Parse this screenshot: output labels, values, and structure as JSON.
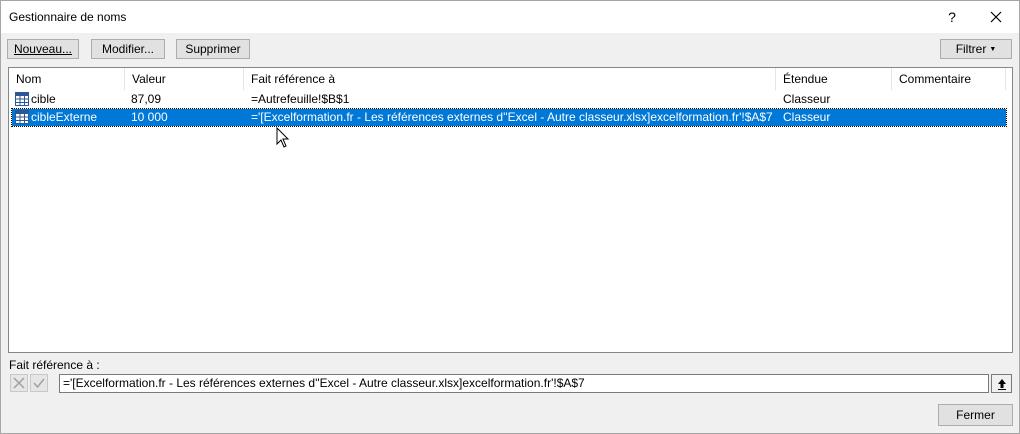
{
  "window": {
    "title": "Gestionnaire de noms",
    "help_label": "?"
  },
  "toolbar": {
    "new_label": "Nouveau...",
    "edit_label": "Modifier...",
    "delete_label": "Supprimer",
    "filter_label": "Filtrer"
  },
  "columns": {
    "name": "Nom",
    "value": "Valeur",
    "refers_to": "Fait référence à",
    "scope": "Étendue",
    "comment": "Commentaire"
  },
  "rows": [
    {
      "name": "cible",
      "value": "87,09",
      "refers_to": "=Autrefeuille!$B$1",
      "scope": "Classeur",
      "comment": ""
    },
    {
      "name": "cibleExterne",
      "value": "10 000",
      "refers_to": "='[Excelformation.fr - Les références externes d''Excel - Autre classeur.xlsx]excelformation.fr'!$A$7",
      "scope": "Classeur",
      "comment": ""
    }
  ],
  "footer": {
    "refers_to_label": "Fait référence à :",
    "refers_to_value": "='[Excelformation.fr - Les références externes d''Excel - Autre classeur.xlsx]excelformation.fr'!$A$7",
    "close_label": "Fermer"
  },
  "colors": {
    "selection": "#0078d7",
    "dialog_bg": "#f0f0f0"
  },
  "selected_row": 2
}
